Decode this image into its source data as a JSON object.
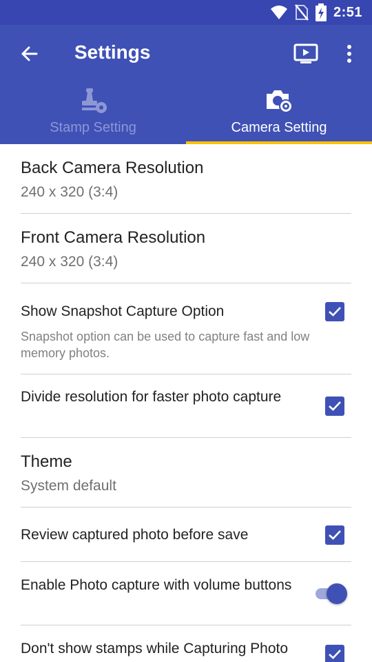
{
  "status_bar": {
    "time": "2:51",
    "icons": [
      "wifi-icon",
      "no-sim-icon",
      "battery-charging-icon"
    ]
  },
  "app_bar": {
    "title": "Settings",
    "back_icon": "arrow-left-icon",
    "actions": [
      "cast-play-icon",
      "more-vert-icon"
    ]
  },
  "tabs": [
    {
      "label": "Stamp Setting",
      "icon": "stamp-gear-icon",
      "active": false
    },
    {
      "label": "Camera Setting",
      "icon": "camera-gear-icon",
      "active": true
    }
  ],
  "settings": {
    "back_camera": {
      "title": "Back Camera Resolution",
      "value": "240 x 320 (3:4)"
    },
    "front_camera": {
      "title": "Front Camera Resolution",
      "value": "240 x 320 (3:4)"
    },
    "snapshot": {
      "title": "Show Snapshot Capture Option",
      "summary": "Snapshot option can be used to capture fast and low memory photos.",
      "checked": true
    },
    "divide_resolution": {
      "title": "Divide resolution for faster photo capture",
      "checked": true
    },
    "theme": {
      "title": "Theme",
      "value": "System default"
    },
    "review_photo": {
      "title": "Review captured photo before save",
      "checked": true
    },
    "volume_capture": {
      "title": "Enable Photo capture with volume buttons",
      "switch_on": true
    },
    "hide_stamps": {
      "title": "Don't show stamps while Capturing Photo",
      "checked": true
    }
  },
  "colors": {
    "primary": "#3f51b5",
    "primary_dark": "#3746b0",
    "accent": "#ffc107"
  }
}
